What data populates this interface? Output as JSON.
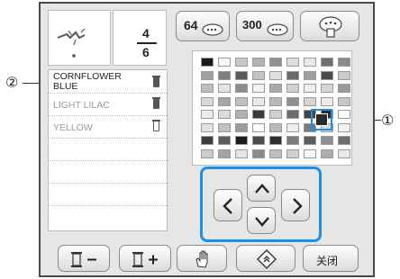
{
  "callouts": {
    "one": "①",
    "two": "②"
  },
  "counter": {
    "current": "4",
    "total": "6"
  },
  "threads": [
    {
      "name_line1": "CORNFLOWER",
      "name_line2": "BLUE",
      "spool": "filled",
      "selected": true
    },
    {
      "name_line1": "LIGHT LILAC",
      "name_line2": "",
      "spool": "filled",
      "selected": false
    },
    {
      "name_line1": "YELLOW",
      "name_line2": "",
      "spool": "outline",
      "selected": false
    }
  ],
  "top_buttons": {
    "b64": "64",
    "b300": "300"
  },
  "bottom_right": {
    "close_label": "关闭"
  },
  "icons": {
    "spool_minus": "spool-minus-icon",
    "spool_plus": "spool-plus-icon",
    "hand": "hand-icon",
    "reset": "reset-diamond-icon",
    "palette": "palette-icon"
  },
  "palette": {
    "rows": [
      [
        "#1a1a1a",
        "#f6f6f6",
        "#c8c8c8",
        "#b4b4b4",
        "#909090",
        "#dedede",
        "#eaeaea",
        "#6e6e6e",
        "#8a8a8a"
      ],
      [
        "#a0a0a0",
        "#7e7e7e",
        "#5a5a5a",
        "#c4c4c4",
        "#e0e0e0",
        "#6a6a6a",
        "#9e9e9e",
        "#4a4a4a",
        "#cacaca"
      ],
      [
        "#bdbdbd",
        "#e4e4e4",
        "#8c8c8c",
        "#f2f2f2",
        "#a8a8a8",
        "#d2d2d2",
        "#f0f0f0",
        "#d6d6d6",
        "#9a9a9a"
      ],
      [
        "#d8d8d8",
        "#a6a6a6",
        "#c0c0c0",
        "#e8e8e8",
        "#b8b8b8",
        "#8e8e8e",
        "#d4d4d4",
        "#ededed",
        "#c6c6c6"
      ],
      [
        "#ececec",
        "#dcdcdc",
        "#b0b0b0",
        "#3a3a3a",
        "#cfcfcf",
        "#6c6c6c",
        "#444444",
        "#2c2c2c",
        "#ffffff"
      ],
      [
        "#e2e2e2",
        "#c2c2c2",
        "#9c9c9c",
        "#ffffff",
        "#bababa",
        "#eeeeee",
        "#7a7a7a",
        "#dadada",
        "#f4f4f4"
      ],
      [
        "#3c3c3c",
        "#5c5c5c",
        "#1c1c1c",
        "#4c4c4c",
        "#2e2e2e",
        "#7c7c7c",
        "#5e5e5e",
        "#909090",
        "#6e6e6e"
      ],
      [
        "#cccccc",
        "#a4a4a4",
        "#e6e6e6",
        "#8a8a8a",
        "#bebebe",
        "#d0d0d0",
        "#f8f8f8",
        "#acacac",
        "#e9e9e9"
      ]
    ],
    "accent": "#1e8ee6"
  }
}
